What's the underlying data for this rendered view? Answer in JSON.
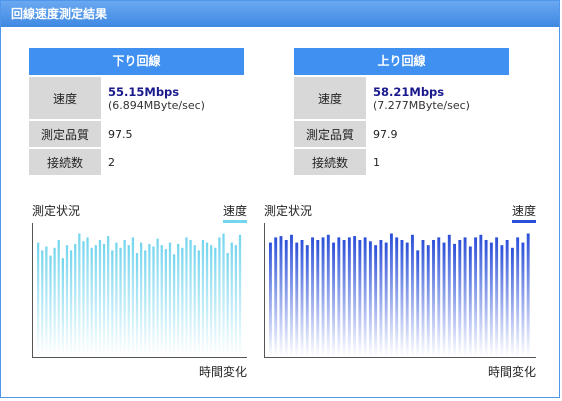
{
  "window": {
    "title": "回線速度測定結果"
  },
  "download": {
    "header": "下り回線",
    "speed_label": "速度",
    "speed_value": "55.15Mbps",
    "speed_sub": "(6.894MByte/sec)",
    "quality_label": "測定品質",
    "quality_value": "97.5",
    "connections_label": "接続数",
    "connections_value": "2"
  },
  "upload": {
    "header": "上り回線",
    "speed_label": "速度",
    "speed_value": "58.21Mbps",
    "speed_sub": "(7.277MByte/sec)",
    "quality_label": "測定品質",
    "quality_value": "97.9",
    "connections_label": "接続数",
    "connections_value": "1"
  },
  "colors": {
    "accent": "#3f90f0",
    "down_bar": "#74d5ee",
    "up_bar": "#2b4fd8"
  },
  "chart_data": [
    {
      "type": "bar",
      "title": "測定状況",
      "xlabel": "時間変化",
      "legend": "速度",
      "legend_position": "top-right",
      "color": "#74d5ee",
      "values": [
        88,
        82,
        85,
        78,
        84,
        90,
        76,
        86,
        82,
        87,
        95,
        89,
        92,
        84,
        86,
        90,
        87,
        93,
        82,
        88,
        84,
        90,
        86,
        92,
        80,
        88,
        82,
        87,
        85,
        91,
        86,
        83,
        88,
        79,
        87,
        84,
        92,
        90,
        86,
        82,
        90,
        88,
        86,
        84,
        92,
        95,
        80,
        88,
        86,
        94
      ]
    },
    {
      "type": "bar",
      "title": "測定状況",
      "xlabel": "時間変化",
      "legend": "速度",
      "legend_position": "top-right",
      "color": "#2b4fd8",
      "values": [
        88,
        92,
        93,
        90,
        94,
        88,
        90,
        86,
        92,
        90,
        92,
        94,
        88,
        92,
        90,
        92,
        93,
        90,
        92,
        89,
        86,
        90,
        88,
        95,
        92,
        90,
        88,
        94,
        82,
        90,
        86,
        90,
        92,
        88,
        94,
        87,
        90,
        92,
        85,
        92,
        94,
        90,
        88,
        92,
        86,
        90,
        84,
        92,
        88,
        95
      ]
    }
  ]
}
